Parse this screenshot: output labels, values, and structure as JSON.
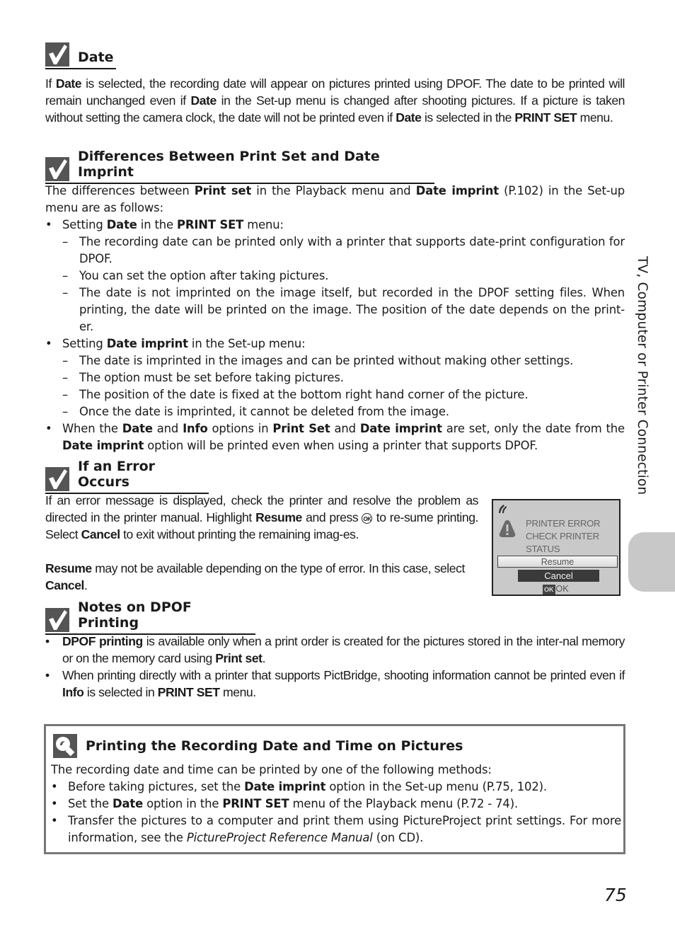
{
  "side_tab": {
    "label": "TV, Computer or Printer Connection"
  },
  "page_number": "75",
  "sections": {
    "date": {
      "title": "Date",
      "body": [
        {
          "t": "If "
        },
        {
          "b": "Date"
        },
        {
          "t": " is selected, the recording date will appear on pictures printed using DPOF. The date to be printed will remain unchanged even if "
        },
        {
          "b": "Date"
        },
        {
          "t": " in the Set-up menu is changed after shooting pictures. If a picture is taken without setting the camera clock, the date will not be printed even if "
        },
        {
          "b": "Date"
        },
        {
          "t": " is selected in the "
        },
        {
          "b": "PRINT SET"
        },
        {
          "t": " menu."
        }
      ]
    },
    "differences": {
      "title": "Differences Between Print Set and Date Imprint",
      "intro": [
        {
          "t": "The differences between "
        },
        {
          "b": "Print set"
        },
        {
          "t": " in the Playback menu and "
        },
        {
          "b": "Date imprint"
        },
        {
          "t": " (P.102) in the Set-up menu are as follows:"
        }
      ],
      "bullets": [
        {
          "text": [
            {
              "t": "Setting "
            },
            {
              "b": "Date"
            },
            {
              "t": " in the "
            },
            {
              "b": "PRINT SET"
            },
            {
              "t": " menu:"
            }
          ],
          "subitems": [
            "The recording date can be printed only with a printer that supports date-print configuration for DPOF.",
            "You can set the option after taking pictures.",
            "The date is not imprinted on the image itself, but recorded in the DPOF setting files. When printing, the date will be printed on the image. The position of the date depends on the print-er."
          ]
        },
        {
          "text": [
            {
              "t": "Setting "
            },
            {
              "b": "Date imprint"
            },
            {
              "t": " in the Set-up menu:"
            }
          ],
          "subitems": [
            "The date is imprinted in the images and can be printed without making other settings.",
            "The option must be set before taking pictures.",
            "The position of the date is fixed at the bottom right hand corner of the picture.",
            "Once the date is imprinted, it cannot be deleted from the image."
          ]
        },
        {
          "text": [
            {
              "t": "When the "
            },
            {
              "b": "Date"
            },
            {
              "t": " and "
            },
            {
              "b": "Info"
            },
            {
              "t": " options in "
            },
            {
              "b": "Print Set"
            },
            {
              "t": " and "
            },
            {
              "b": "Date imprint"
            },
            {
              "t": " are set, only the date from the "
            },
            {
              "b": "Date imprint"
            },
            {
              "t": " option will be printed even when using a printer that supports DPOF."
            }
          ],
          "subitems": []
        }
      ]
    },
    "error": {
      "title": "If an Error Occurs",
      "para1": [
        {
          "t": "If an error message is displayed, check the printer and resolve the problem as directed in the printer manual. Highlight "
        },
        {
          "b": "Resume"
        },
        {
          "t": " and press "
        },
        {
          "icon": "OK"
        },
        {
          "t": " to re-sume printing. Select "
        },
        {
          "b": "Cancel"
        },
        {
          "t": " to exit without printing the remaining imag-es."
        }
      ],
      "para2": [
        {
          "b": "Resume"
        },
        {
          "t": " may not be available depending on the type of error. In this case, select "
        },
        {
          "b": "Cancel"
        },
        {
          "t": "."
        }
      ],
      "screen": {
        "message_lines": [
          "PRINTER ERROR",
          "CHECK PRINTER",
          "STATUS"
        ],
        "options": [
          "Resume",
          "Cancel"
        ],
        "selected_option": "Cancel",
        "ok_badge": "OK",
        "ok_label": "OK"
      }
    },
    "dpof_notes": {
      "title": "Notes on DPOF Printing",
      "bullets": [
        [
          {
            "b": "DPOF printing"
          },
          {
            "t": " is available only when a print order is created for the pictures stored in the inter-nal memory or on the memory card using "
          },
          {
            "b": "Print set"
          },
          {
            "t": "."
          }
        ],
        [
          {
            "t": "When printing directly with a printer that supports PictBridge, shooting information cannot be printed even if "
          },
          {
            "b": "Info"
          },
          {
            "t": " is selected in "
          },
          {
            "b": "PRINT SET"
          },
          {
            "t": " menu."
          }
        ]
      ]
    },
    "tip": {
      "title": "Printing the Recording Date and Time on Pictures",
      "intro": "The recording date and time can be printed by one of the following methods:",
      "bullets": [
        [
          {
            "t": "Before taking pictures, set the "
          },
          {
            "b": "Date imprint"
          },
          {
            "t": " option in the Set-up menu (P.75, 102)."
          }
        ],
        [
          {
            "t": "Set the "
          },
          {
            "b": "Date"
          },
          {
            "t": " option in the "
          },
          {
            "b": "PRINT SET"
          },
          {
            "t": " menu of the Playback menu (P.72 - 74)."
          }
        ],
        [
          {
            "t": "Transfer the pictures to a computer and print them using PictureProject print settings. For more information, see the "
          },
          {
            "i": "PictureProject Reference Manual"
          },
          {
            "t": " (on CD)."
          }
        ]
      ]
    }
  }
}
